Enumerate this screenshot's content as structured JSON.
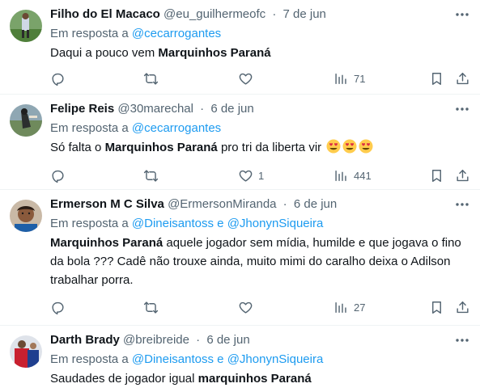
{
  "tweets": [
    {
      "name": "Filho do El Macaco",
      "handle": "@eu_guilhermeofc",
      "date": "7 de jun",
      "reply_prefix": "Em resposta a",
      "mention_1": "@cecarrogantes",
      "mention_join": "",
      "mention_2": "",
      "body_pre": "Daqui a pouco vem",
      "body_bold": "Marquinhos Paraná",
      "body_post": "",
      "likes": "",
      "views": "71"
    },
    {
      "name": "Felipe Reis",
      "handle": "@30marechal",
      "date": "6 de jun",
      "reply_prefix": "Em resposta a",
      "mention_1": "@cecarrogantes",
      "mention_join": "",
      "mention_2": "",
      "body_pre": "Só falta o",
      "body_bold": "Marquinhos Paraná",
      "body_post": "pro tri da liberta vir",
      "likes": "1",
      "views": "441"
    },
    {
      "name": "Ermerson M C Silva",
      "handle": "@ErmersonMiranda",
      "date": "6 de jun",
      "reply_prefix": "Em resposta a",
      "mention_1": "@Dineisantoss",
      "mention_join": "e",
      "mention_2": "@JhonynSiqueira",
      "body_pre": "",
      "body_bold": "Marquinhos Paraná",
      "body_post": "aquele jogador sem mídia, humilde e que jogava o fino da bola ??? Cadê não trouxe ainda, muito mimi do caralho deixa o Adilson trabalhar porra.",
      "likes": "",
      "views": "27"
    },
    {
      "name": "Darth Brady",
      "handle": "@breibreide",
      "date": "6 de jun",
      "reply_prefix": "Em resposta a",
      "mention_1": "@Dineisantoss",
      "mention_join": "e",
      "mention_2": "@JhonynSiqueira",
      "body_pre": "Saudades de jogador igual",
      "body_bold": "marquinhos Paraná",
      "body_post": "",
      "likes": "",
      "views": ""
    }
  ],
  "separator": "·",
  "icons": {
    "reply": "reply-icon",
    "retweet": "retweet-icon",
    "like": "heart-icon",
    "views": "views-icon",
    "bookmark": "bookmark-icon",
    "share": "share-icon",
    "more": "more-icon",
    "emoji": "heart-eyes-emoji"
  },
  "colors": {
    "text": "#0f1419",
    "secondary": "#536471",
    "link": "#1d9bf0",
    "divider": "#eff3f4"
  }
}
